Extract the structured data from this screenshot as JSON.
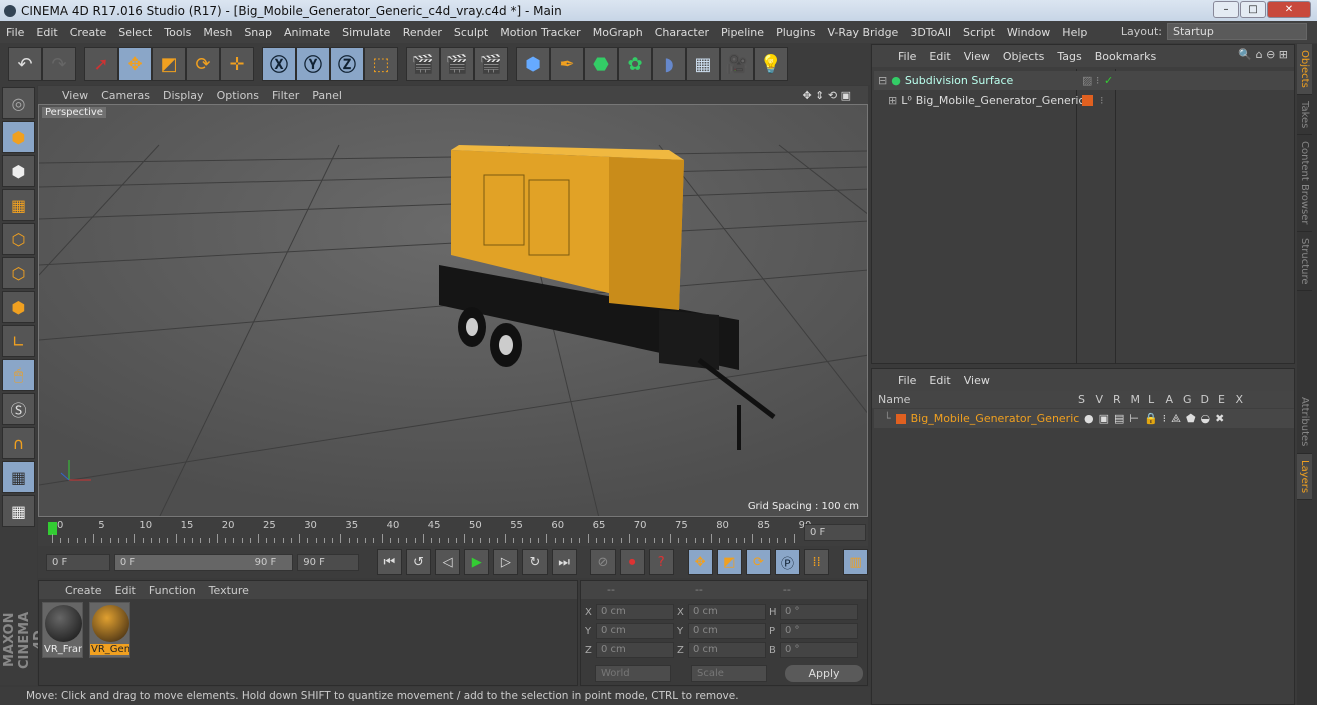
{
  "window": {
    "title": "CINEMA 4D R17.016 Studio (R17) - [Big_Mobile_Generator_Generic_c4d_vray.c4d *] - Main"
  },
  "menu": [
    "File",
    "Edit",
    "Create",
    "Select",
    "Tools",
    "Mesh",
    "Snap",
    "Animate",
    "Simulate",
    "Render",
    "Sculpt",
    "Motion Tracker",
    "MoGraph",
    "Character",
    "Pipeline",
    "Plugins",
    "V-Ray Bridge",
    "3DToAll",
    "Script",
    "Window",
    "Help"
  ],
  "layout": {
    "label": "Layout:",
    "value": "Startup"
  },
  "viewport": {
    "menu": [
      "View",
      "Cameras",
      "Display",
      "Options",
      "Filter",
      "Panel"
    ],
    "camera": "Perspective",
    "grid_spacing": "Grid Spacing : 100 cm"
  },
  "timeline": {
    "ticks": [
      "0",
      "5",
      "10",
      "15",
      "20",
      "25",
      "30",
      "35",
      "40",
      "45",
      "50",
      "55",
      "60",
      "65",
      "70",
      "75",
      "80",
      "85",
      "90"
    ],
    "current": "0 F",
    "start": "0 F",
    "range_start": "0 F",
    "range_end": "90 F",
    "end": "90 F"
  },
  "materials": {
    "menu": [
      "Create",
      "Edit",
      "Function",
      "Texture"
    ],
    "items": [
      {
        "name": "VR_Fran",
        "selected": false
      },
      {
        "name": "VR_Gen",
        "selected": true
      }
    ]
  },
  "coords": {
    "headers": [
      "--",
      "--",
      "--"
    ],
    "rows": [
      [
        "X",
        "0 cm",
        "X",
        "0 cm",
        "H",
        "0 °"
      ],
      [
        "Y",
        "0 cm",
        "Y",
        "0 cm",
        "P",
        "0 °"
      ],
      [
        "Z",
        "0 cm",
        "Z",
        "0 cm",
        "B",
        "0 °"
      ]
    ],
    "mode": "World",
    "scale": "Scale",
    "apply": "Apply"
  },
  "status": "Move: Click and drag to move elements. Hold down SHIFT to quantize movement / add to the selection in point mode, CTRL to remove.",
  "objects": {
    "menu": [
      "File",
      "Edit",
      "View",
      "Objects",
      "Tags",
      "Bookmarks"
    ],
    "items": [
      {
        "name": "Subdivision Surface"
      },
      {
        "name": "Big_Mobile_Generator_Generic"
      }
    ]
  },
  "layers": {
    "menu": [
      "File",
      "Edit",
      "View"
    ],
    "columns": [
      "Name",
      "S",
      "V",
      "R",
      "M",
      "L",
      "A",
      "G",
      "D",
      "E",
      "X"
    ],
    "items": [
      {
        "name": "Big_Mobile_Generator_Generic",
        "color": "#e06020"
      }
    ]
  },
  "side_tabs": [
    "Objects",
    "Takes",
    "Content Browser",
    "Structure",
    "Attributes",
    "Layers"
  ],
  "colors": {
    "accent": "#f0a020",
    "selected_tool": "#8aa6c8"
  }
}
